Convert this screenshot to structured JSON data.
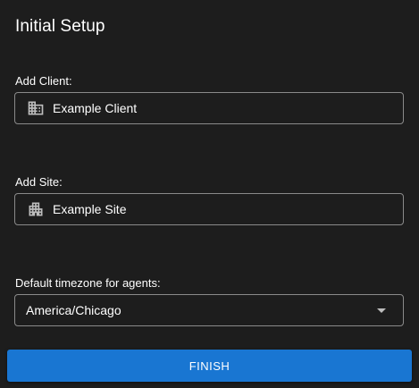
{
  "dialog": {
    "title": "Initial Setup"
  },
  "client": {
    "label": "Add Client:",
    "value": "Example Client",
    "icon": "business-building-icon"
  },
  "site": {
    "label": "Add Site:",
    "value": "Example Site",
    "icon": "apartment-building-icon"
  },
  "timezone": {
    "label": "Default timezone for agents:",
    "value": "America/Chicago",
    "icon": "arrow-drop-down-icon"
  },
  "actions": {
    "finish_label": "FINISH"
  },
  "colors": {
    "background": "#1d1d1d",
    "field_border": "#8a8a8a",
    "primary": "#1976d2",
    "icon": "#bdbdbd"
  }
}
